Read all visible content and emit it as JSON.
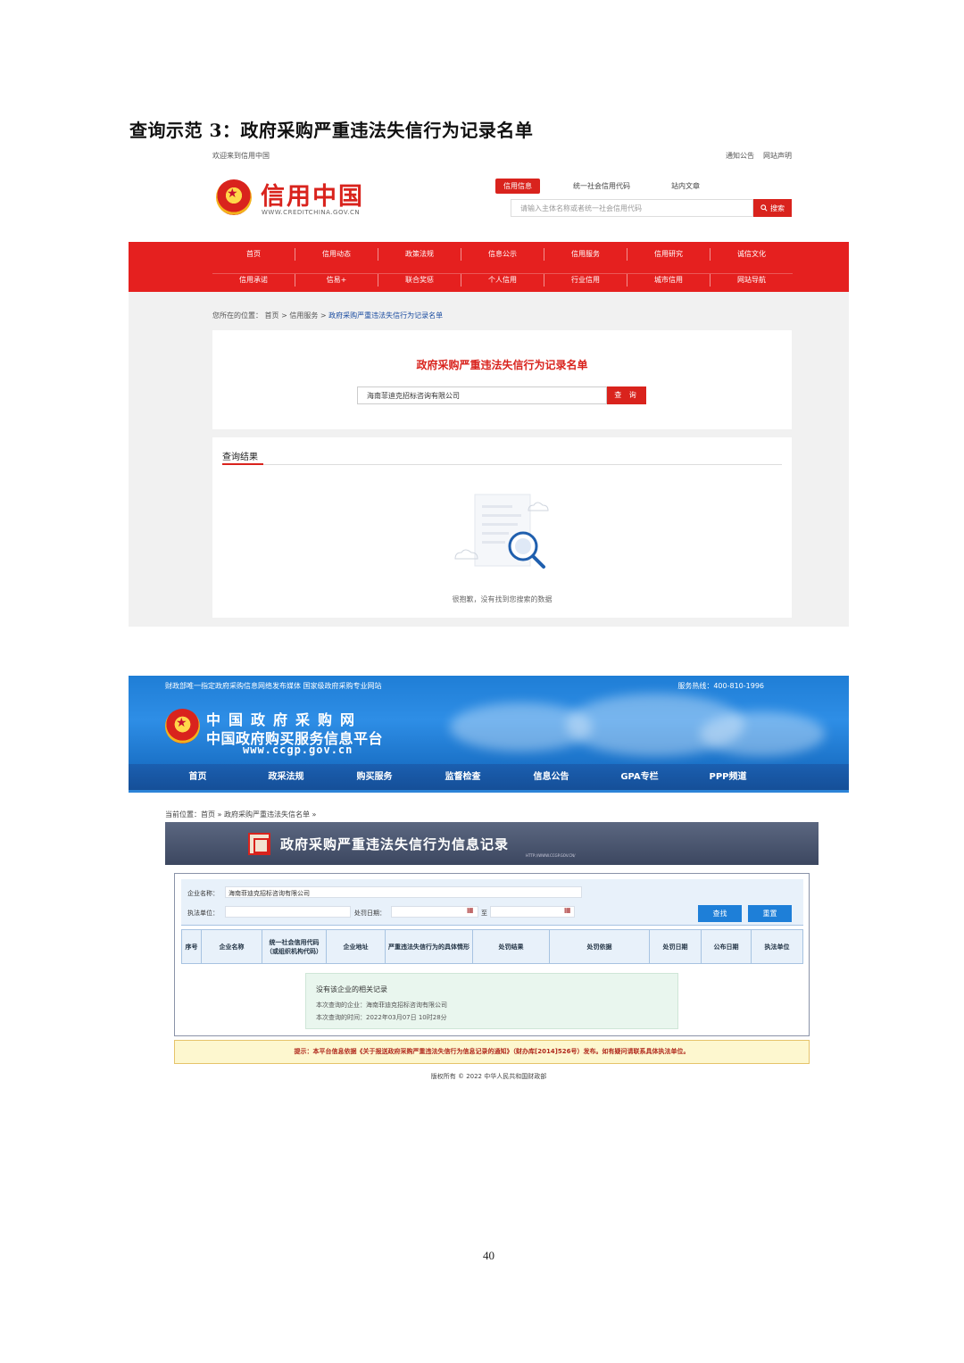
{
  "heading": "查询示范 3：政府采购严重违法失信行为记录名单",
  "credit_china": {
    "welcome": "欢迎来到信用中国",
    "top_links": [
      "通知公告",
      "网站声明"
    ],
    "logo_text": "信用中国",
    "logo_url": "WWW.CREDITCHINA.GOV.CN",
    "search_tabs": [
      "信用信息",
      "统一社会信用代码",
      "站内文章"
    ],
    "search_placeholder": "请输入主体名称或者统一社会信用代码",
    "search_button": "搜索",
    "nav_row1": [
      "首页",
      "信用动态",
      "政策法规",
      "信息公示",
      "信用服务",
      "信用研究",
      "诚信文化"
    ],
    "nav_row2": [
      "信用承诺",
      "信易+",
      "联合奖惩",
      "个人信用",
      "行业信用",
      "城市信用",
      "网站导航"
    ],
    "breadcrumb_prefix": "您所在的位置：",
    "breadcrumb": [
      "首页",
      "信用服务"
    ],
    "breadcrumb_current": "政府采购严重违法失信行为记录名单",
    "query_title": "政府采购严重违法失信行为记录名单",
    "query_value": "海南菲迪克招标咨询有限公司",
    "query_button": "查 询",
    "result_title": "查询结果",
    "empty_text": "很抱歉，没有找到您搜索的数据"
  },
  "ccgp": {
    "top_line": "财政部唯一指定政府采购信息网络发布媒体 国家级政府采购专业网站",
    "hotline": "服务热线：400-810-1996",
    "logo_line1": "中国政府采购网",
    "logo_line2": "中国政府购买服务信息平台",
    "logo_url": "www.ccgp.gov.cn",
    "nav": [
      "首页",
      "政采法规",
      "购买服务",
      "监督检查",
      "信息公告",
      "GPA专栏",
      "PPP频道"
    ],
    "breadcrumb": "当前位置：首页 » 政府采购严重违法失信名单 »",
    "title": "政府采购严重违法失信行为信息记录",
    "title_url": "HTTP://WWW.CCGP.GOV.CN/",
    "form": {
      "company_label": "企业名称：",
      "company_value": "海南菲迪克招标咨询有限公司",
      "unit_label": "执法单位：",
      "date_label": "处罚日期：",
      "to_label": "至",
      "search_button": "查找",
      "reset_button": "重置"
    },
    "columns": [
      "序号",
      "企业名称",
      "统一社会信用代码（或组织机构代码）",
      "企业地址",
      "严重违法失信行为的具体情形",
      "处罚结果",
      "处罚依据",
      "处罚日期",
      "公布日期",
      "执法单位"
    ],
    "message": {
      "title": "没有该企业的相关记录",
      "company_line": "本次查询的企业：海南菲迪克招标咨询有限公司",
      "time_line": "本次查询的时间：2022年03月07日 10时28分"
    },
    "notice": "提示：本平台信息依据《关于报送政府采购严重违法失信行为信息记录的通知》（财办库[2014]526号）发布。如有疑问请联系具体执法单位。",
    "copyright": "版权所有 © 2022 中华人民共和国财政部"
  },
  "page_number": "40",
  "colors": {
    "credit_red": "#e5201f",
    "ccgp_blue": "#1f7ed6",
    "ccgp_nav": "#154f98"
  }
}
